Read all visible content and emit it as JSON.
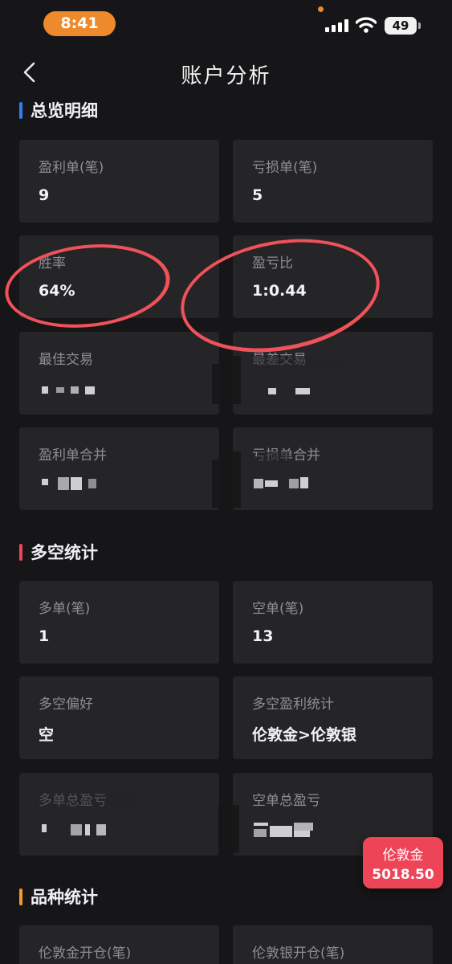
{
  "status_bar": {
    "time": "8:41",
    "battery": "49"
  },
  "nav": {
    "title": "账户分析"
  },
  "colors": {
    "accent_orange": "#ee8a2c",
    "section_blue": "#2f7ef5",
    "section_red": "#f0445a",
    "section_orange": "#f39a2a",
    "annotation_red": "#f0525a",
    "badge_red": "#ee4458"
  },
  "sections": {
    "overview": {
      "title": "总览明细",
      "cards": [
        {
          "label": "盈利单(笔)",
          "value": "9"
        },
        {
          "label": "亏损单(笔)",
          "value": "5"
        },
        {
          "label": "胜率",
          "value": "64%"
        },
        {
          "label": "盈亏比",
          "value": "1:0.44"
        },
        {
          "label": "最佳交易",
          "value": ""
        },
        {
          "label": "最差交易",
          "value": ""
        },
        {
          "label": "盈利单合并",
          "value": ""
        },
        {
          "label": "亏损单合并",
          "value": ""
        }
      ]
    },
    "long_short": {
      "title": "多空统计",
      "cards": [
        {
          "label": "多单(笔)",
          "value": "1"
        },
        {
          "label": "空单(笔)",
          "value": "13"
        },
        {
          "label": "多空偏好",
          "value": "空"
        },
        {
          "label": "多空盈利统计",
          "value": "伦敦金>伦敦银"
        },
        {
          "label": "多单总盈亏",
          "value": ""
        },
        {
          "label": "空单总盈亏",
          "value": ""
        }
      ]
    },
    "variety": {
      "title": "品种统计",
      "cards": [
        {
          "label": "伦敦金开仓(笔)",
          "value": ""
        },
        {
          "label": "伦敦银开仓(笔)",
          "value": ""
        }
      ]
    }
  },
  "price_badge": {
    "name": "伦敦金",
    "price": "5018.50"
  }
}
